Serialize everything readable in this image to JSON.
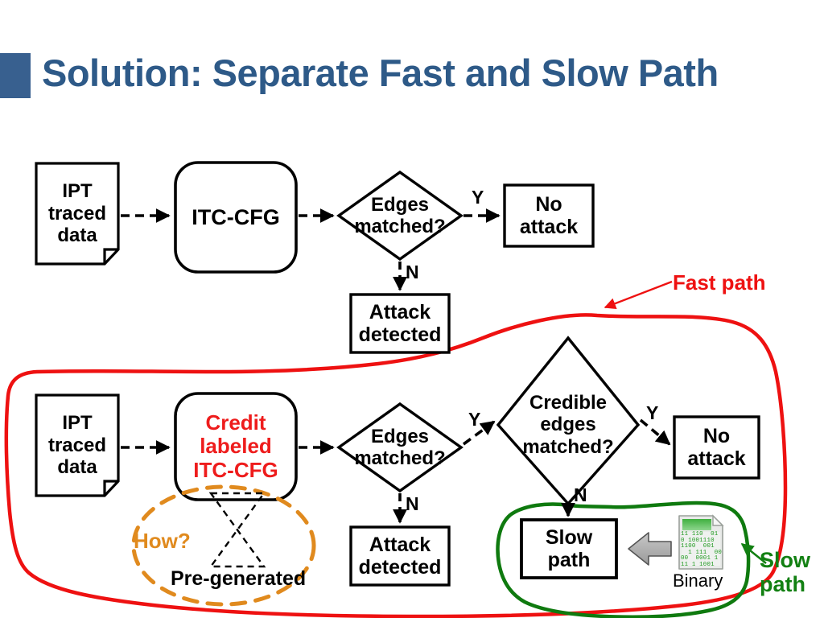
{
  "slide": {
    "title": "Solution: Separate Fast and Slow Path",
    "accent_color": "#38608f",
    "title_color": "#2e5a88"
  },
  "colors": {
    "fast_path": "#ee1111",
    "slow_path": "#128012",
    "how_highlight": "#e08a1e",
    "credit_label": "#ee1c1c",
    "stroke": "#000000"
  },
  "fast_path_flow": {
    "nodes": [
      {
        "id": "ipt-data-top",
        "shape": "document",
        "lines": [
          "IPT",
          "traced",
          "data"
        ]
      },
      {
        "id": "itc-cfg-top",
        "shape": "rounded-rect",
        "lines": [
          "ITC-CFG"
        ]
      },
      {
        "id": "edges-matched-top",
        "shape": "diamond",
        "lines": [
          "Edges",
          "matched?"
        ]
      },
      {
        "id": "no-attack-top",
        "shape": "rect",
        "lines": [
          "No",
          "attack"
        ]
      },
      {
        "id": "attack-detected-top",
        "shape": "rect",
        "lines": [
          "Attack",
          "detected"
        ]
      }
    ],
    "edge_labels": {
      "yes": "Y",
      "no": "N"
    }
  },
  "slow_path_flow": {
    "nodes": [
      {
        "id": "ipt-data-bottom",
        "shape": "document",
        "lines": [
          "IPT",
          "traced",
          "data"
        ]
      },
      {
        "id": "credit-itc-cfg",
        "shape": "rounded-rect",
        "lines": [
          "Credit",
          "labeled",
          "ITC-CFG"
        ]
      },
      {
        "id": "edges-matched-bottom",
        "shape": "diamond",
        "lines": [
          "Edges",
          "matched?"
        ]
      },
      {
        "id": "credible-edges-matched",
        "shape": "diamond",
        "lines": [
          "Credible",
          "edges",
          "matched?"
        ]
      },
      {
        "id": "no-attack-bottom",
        "shape": "rect",
        "lines": [
          "No",
          "attack"
        ]
      },
      {
        "id": "attack-detected-bottom",
        "shape": "rect",
        "lines": [
          "Attack",
          "detected"
        ]
      },
      {
        "id": "slow-path-box",
        "shape": "rect",
        "lines": [
          "Slow",
          "path"
        ]
      }
    ],
    "edge_labels": {
      "yes": "Y",
      "no": "N"
    }
  },
  "annotations": {
    "fast_path_label": "Fast path",
    "slow_path_label_line1": "Slow",
    "slow_path_label_line2": "path",
    "how_label": "How?",
    "pre_generated_label": "Pre-generated",
    "binary_caption": "Binary"
  },
  "binary_icon": {
    "name": "binary-file-icon",
    "digit_rows": [
      "11 110  01",
      "0 1001110",
      "1100  001",
      "  1 111  00",
      "00  0001 1",
      "11 1 1001"
    ]
  }
}
